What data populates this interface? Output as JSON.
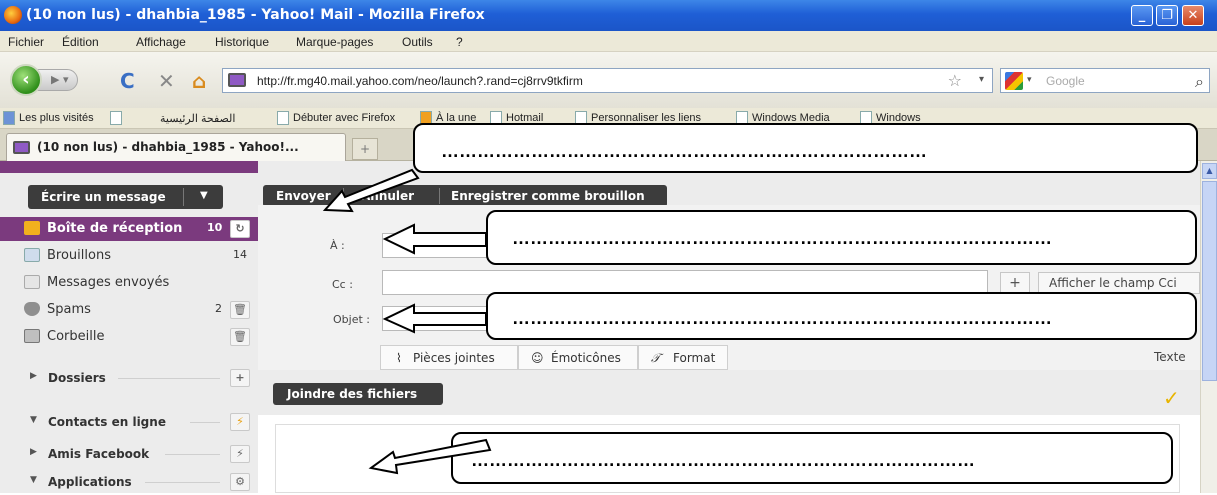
{
  "window": {
    "title": "(10 non lus) - dhahbia_1985 - Yahoo! Mail - Mozilla Firefox",
    "controls": [
      "_",
      "❐",
      "✕"
    ]
  },
  "menu": [
    "Fichier",
    "Édition",
    "Affichage",
    "Historique",
    "Marque-pages",
    "Outils",
    "?"
  ],
  "navigation": {
    "url": "http://fr.mg40.mail.yahoo.com/neo/launch?.rand=cj8rrv9tkfirm",
    "search_placeholder": "Google"
  },
  "bookmarks": [
    "Les plus visités",
    "الصفحة الرئيسية",
    "Débuter avec Firefox",
    "À la une",
    "Hotmail",
    "Personnaliser les liens",
    "Windows Media",
    "Windows"
  ],
  "tab": {
    "label": "(10 non lus) - dhahbia_1985 - Yahoo!...",
    "new_tab": "+"
  },
  "sidebar": {
    "compose_label": "Écrire un message",
    "folders": [
      {
        "label": "Boîte de réception",
        "count": "10"
      },
      {
        "label": "Brouillons",
        "count": "14"
      },
      {
        "label": "Messages envoyés",
        "count": ""
      },
      {
        "label": "Spams",
        "count": "2"
      },
      {
        "label": "Corbeille",
        "count": ""
      }
    ],
    "sections": [
      "Dossiers",
      "Contacts en ligne",
      "Amis Facebook",
      "Applications"
    ]
  },
  "compose": {
    "toolbar": {
      "send": "Envoyer",
      "cancel": "Annuler",
      "save_draft": "Enregistrer comme brouillon"
    },
    "to_label": "À :",
    "cc_label": "Cc :",
    "subject_label": "Objet :",
    "add_button": "+",
    "bcc_link": "Afficher le champ Cci",
    "tabs": [
      "Pièces jointes",
      "Émoticônes",
      "Format"
    ],
    "text_mode": "Texte",
    "attach_button": "Joindre des fichiers"
  },
  "callouts": {
    "c1": "………………………………………………………………………",
    "c2": "………………………………………………………………………………",
    "c3": "………………………………………………………………………………",
    "c4": "…………………………………………………………………………"
  }
}
